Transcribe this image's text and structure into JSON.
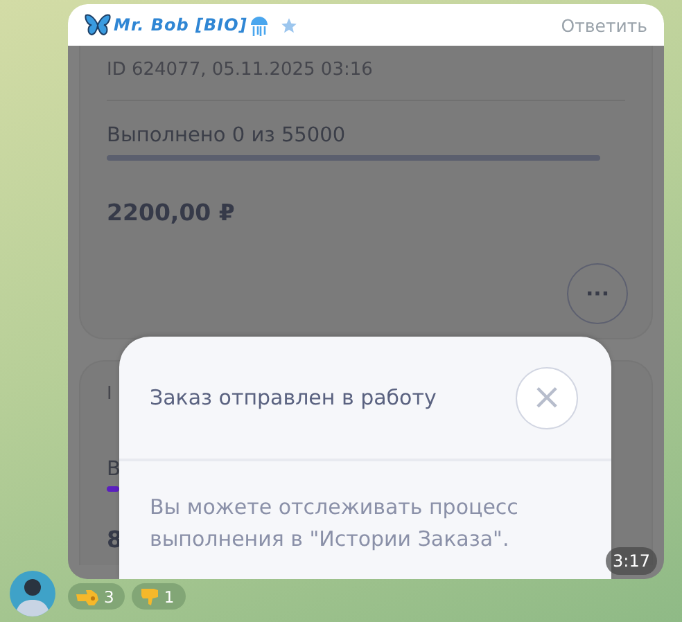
{
  "message": {
    "sender": "Mr. Bob [BIO]",
    "reply_action": "Ответить",
    "time": "3:17"
  },
  "order_card": {
    "id_line": "ID 624077, 05.11.2025 03:16",
    "progress_text": "Выполнено 0 из 55000",
    "level": 0,
    "price": "2200,00 ₽",
    "more_button": "···"
  },
  "next_card": {
    "fragments": [
      "I",
      "В",
      "8"
    ]
  },
  "modal": {
    "title": "Заказ отправлен в работу",
    "close": "×",
    "body": "Вы можете отслеживать процесс выполнения в \"Истории Заказа\"."
  },
  "reactions": [
    {
      "kind": "pointing",
      "count": "3"
    },
    {
      "kind": "dislike",
      "count": "1"
    }
  ]
}
